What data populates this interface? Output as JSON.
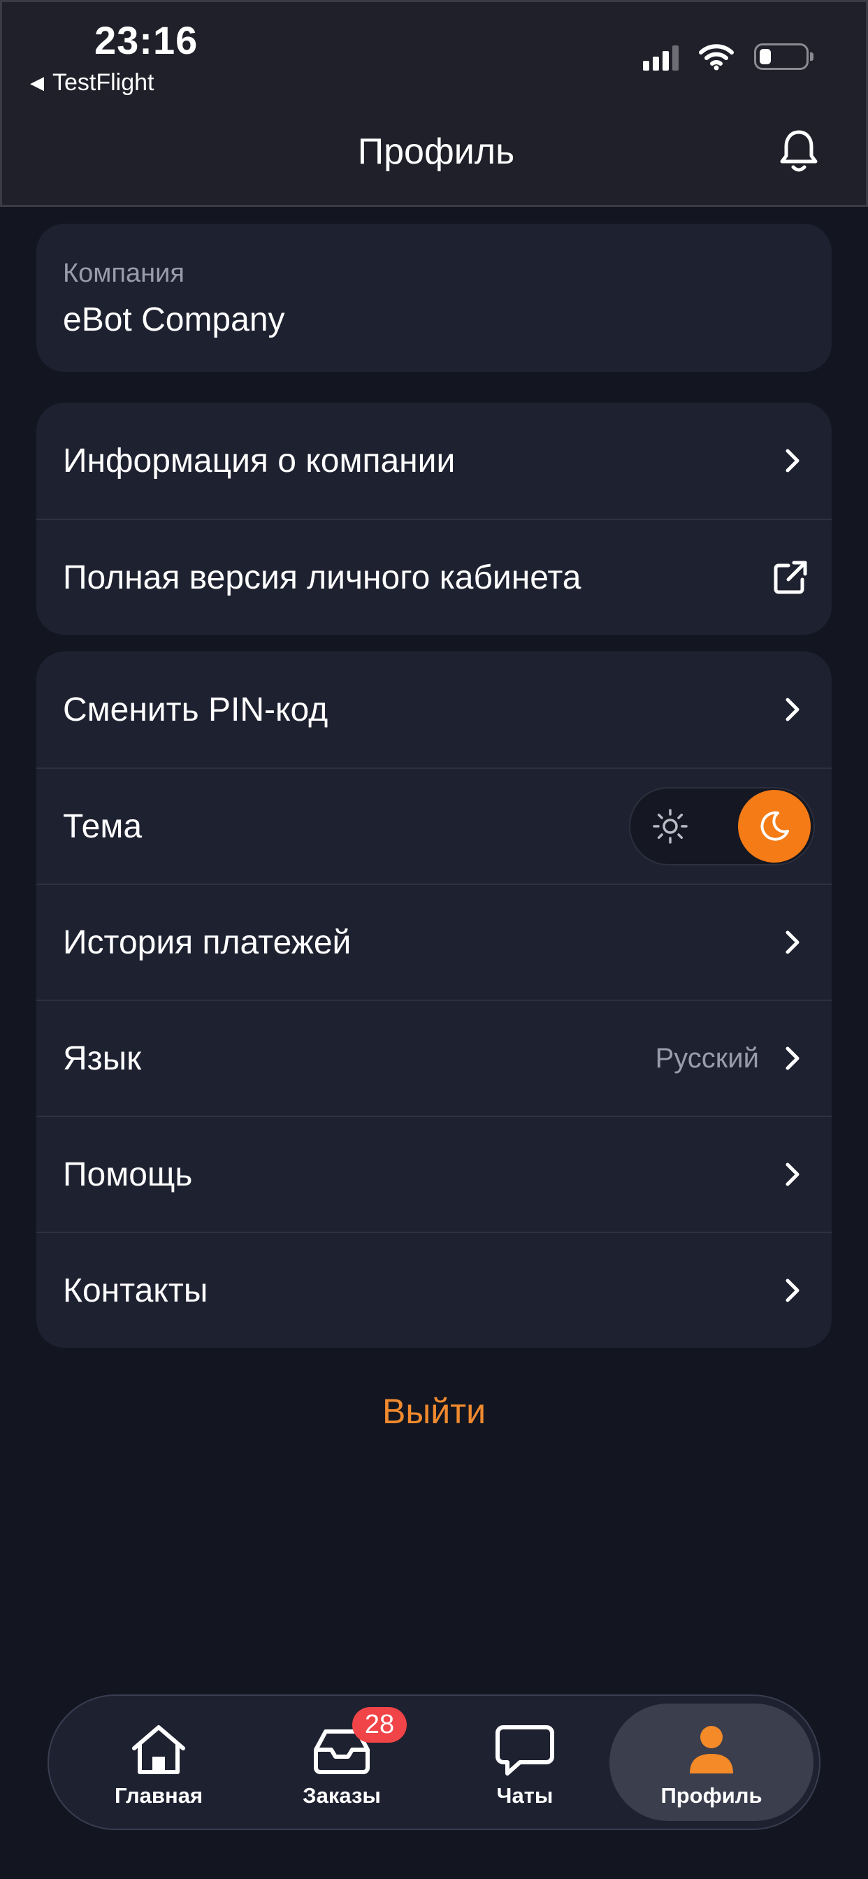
{
  "status_bar": {
    "time": "23:16",
    "back_app": "TestFlight"
  },
  "header": {
    "title": "Профиль"
  },
  "company": {
    "label": "Компания",
    "name": "eBot Company"
  },
  "group1": {
    "items": [
      {
        "label": "Информация о компании",
        "icon": "chevron-right-icon"
      },
      {
        "label": "Полная версия личного кабинета",
        "icon": "external-link-icon"
      }
    ]
  },
  "group2": {
    "items": [
      {
        "label": "Сменить PIN-код"
      },
      {
        "label": "Тема",
        "toggle": "dark"
      },
      {
        "label": "История платежей"
      },
      {
        "label": "Язык",
        "value": "Русский"
      },
      {
        "label": "Помощь"
      },
      {
        "label": "Контакты"
      }
    ]
  },
  "logout_label": "Выйти",
  "tabbar": {
    "tabs": [
      {
        "label": "Главная",
        "icon": "home-icon"
      },
      {
        "label": "Заказы",
        "icon": "inbox-icon",
        "badge": "28"
      },
      {
        "label": "Чаты",
        "icon": "chat-icon"
      },
      {
        "label": "Профиль",
        "icon": "user-icon",
        "active": true
      }
    ]
  },
  "colors": {
    "accent": "#f47b16",
    "background": "#131621",
    "card": "#1e2130",
    "badge": "#f04448"
  }
}
